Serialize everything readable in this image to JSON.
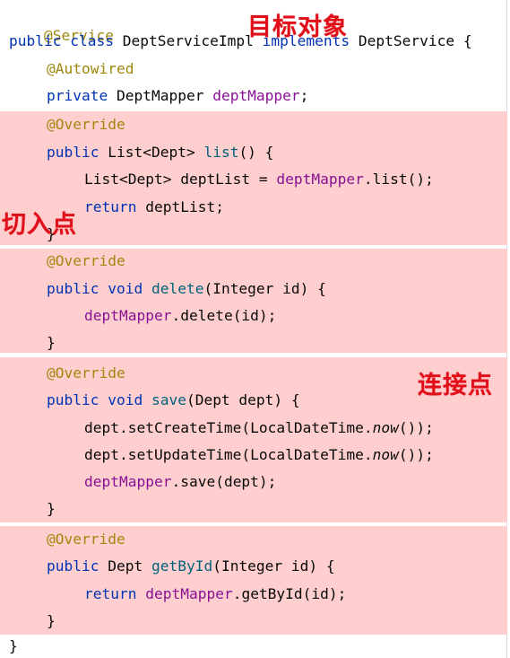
{
  "code": {
    "l1_anno": "@Service",
    "l2_public": "public",
    "l2_class": "class",
    "l2_name": "DeptServiceImpl",
    "l2_implements": "implements",
    "l2_iface": "DeptService {",
    "l3_anno": "@Autowired",
    "l4_private": "private",
    "l4_type": "DeptMapper",
    "l4_field": "deptMapper",
    "l4_semi": ";",
    "override": "@Override",
    "m1_public": "public",
    "m1_sig_pre": "List<Dept>",
    "m1_name": "list",
    "m1_sig_post": "() {",
    "m1_b1_pre": "List<Dept> deptList = ",
    "m1_b1_field": "deptMapper",
    "m1_b1_post": ".list();",
    "m1_b2_return": "return",
    "m1_b2_rest": "deptList;",
    "close_brace": "}",
    "m2_public": "public",
    "m2_void": "void",
    "m2_name": "delete",
    "m2_sig_post": "(Integer id) {",
    "m2_b1_field": "deptMapper",
    "m2_b1_post": ".delete(id);",
    "m3_public": "public",
    "m3_void": "void",
    "m3_name": "save",
    "m3_sig_post": "(Dept dept) {",
    "m3_b1_pre": "dept.setCreateTime(LocalDateTime.",
    "m3_now": "now",
    "m3_b1_post": "());",
    "m3_b2_pre": "dept.setUpdateTime(LocalDateTime.",
    "m3_b2_post": "());",
    "m3_b3_field": "deptMapper",
    "m3_b3_post": ".save(dept);",
    "m4_public": "public",
    "m4_type": "Dept",
    "m4_name": "getById",
    "m4_sig_post": "(Integer id) {",
    "m4_b1_return": "return",
    "m4_b1_field": "deptMapper",
    "m4_b1_post": ".getById(id);"
  },
  "annotations": {
    "target_object": "目标对象",
    "pointcut": "切入点",
    "join_point": "连接点",
    "color": "#e0101b"
  },
  "colors": {
    "highlight": "#ffcfcf",
    "annotation": "#9e880d",
    "keyword": "#0033b3",
    "field": "#871094",
    "method": "#00627a"
  }
}
